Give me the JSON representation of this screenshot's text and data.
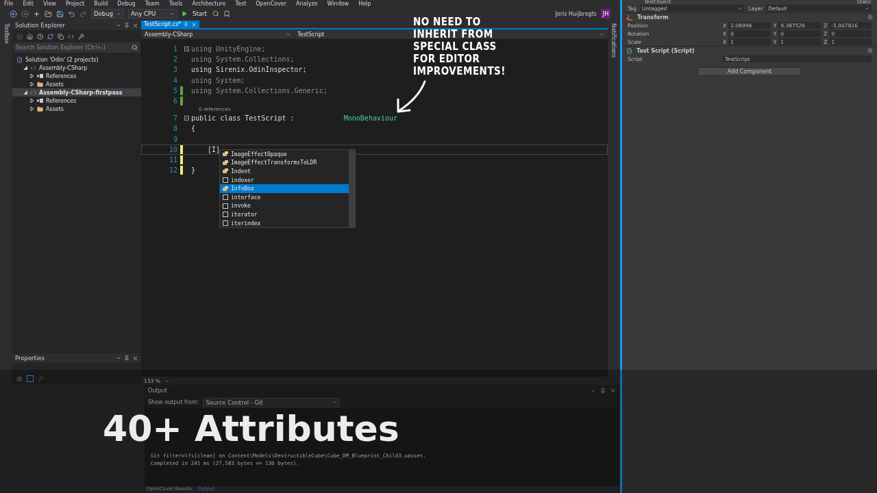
{
  "menu": [
    "File",
    "Edit",
    "View",
    "Project",
    "Build",
    "Debug",
    "Team",
    "Tools",
    "Architecture",
    "Test",
    "OpenCover",
    "Analyze",
    "Window",
    "Help"
  ],
  "toolbar": {
    "configuration": "Debug",
    "platform": "Any CPU",
    "start": "Start",
    "user": "Joris Huijbregts",
    "avatar": "JH"
  },
  "side_tabs": {
    "left": "Toolbox",
    "right": "Notifications"
  },
  "solution_explorer": {
    "title": "Solution Explorer",
    "search": {
      "placeholder": "Search Solution Explorer (Ctrl+;)"
    },
    "tree": [
      {
        "label": "Solution 'Odin' (2 projects)",
        "kind": "solution",
        "selected": false,
        "children": [
          {
            "label": "Assembly-CSharp",
            "kind": "project",
            "expanded": true,
            "selected": false,
            "children": [
              {
                "label": "References",
                "kind": "references",
                "expanded": false,
                "selected": false
              },
              {
                "label": "Assets",
                "kind": "folder",
                "expanded": false,
                "selected": false
              }
            ]
          },
          {
            "label": "Assembly-CSharp-firstpass",
            "kind": "project",
            "expanded": true,
            "selected": true,
            "children": [
              {
                "label": "References",
                "kind": "references",
                "expanded": false,
                "selected": false
              },
              {
                "label": "Assets",
                "kind": "folder",
                "expanded": false,
                "selected": false
              }
            ]
          }
        ]
      }
    ]
  },
  "properties": {
    "title": "Properties"
  },
  "editor": {
    "tab": "TestScript.cs*",
    "nav_project": "Assembly-CSharp",
    "nav_class": "TestScript",
    "codelens": "0 references",
    "zoom": "133 %",
    "lines": [
      {
        "number": "1",
        "fold": true,
        "current": false,
        "changed": false,
        "tokens": [
          {
            "text": "using UnityEngine;",
            "kind": "unused"
          }
        ]
      },
      {
        "number": "2",
        "fold": false,
        "current": false,
        "changed": false,
        "tokens": [
          {
            "text": "using System.Collections;",
            "kind": "unused"
          }
        ]
      },
      {
        "number": "3",
        "fold": false,
        "current": false,
        "changed": false,
        "tokens": [
          {
            "text": "using Sirenix.OdinInspector;",
            "kind": "plain"
          }
        ]
      },
      {
        "number": "4",
        "fold": false,
        "current": false,
        "changed": false,
        "tokens": [
          {
            "text": "using System;",
            "kind": "unused"
          }
        ]
      },
      {
        "number": "5",
        "fold": false,
        "current": false,
        "changed": true,
        "color": "#57a64a",
        "tokens": [
          {
            "text": "using System.Collections.Generic;",
            "kind": "unused"
          }
        ]
      },
      {
        "number": "6",
        "fold": false,
        "current": false,
        "changed": true,
        "color": "#57a64a"
      },
      {
        "number": "7",
        "fold": true,
        "current": false,
        "changed": false,
        "lens": true,
        "tokens": [
          {
            "text": "public class TestScript :            ",
            "kind": "plain"
          },
          {
            "text": "MonoBehaviour",
            "kind": "type"
          }
        ]
      },
      {
        "number": "8",
        "fold": false,
        "current": false,
        "changed": false,
        "tokens": [
          {
            "text": "{",
            "kind": "plain"
          }
        ]
      },
      {
        "number": "9",
        "fold": false,
        "current": false,
        "changed": false
      },
      {
        "number": "10",
        "fold": false,
        "current": true,
        "changed": true,
        "color": "#efeb7a",
        "tokens": [
          {
            "text": "    [I]",
            "kind": "plain"
          }
        ]
      },
      {
        "number": "11",
        "fold": false,
        "current": false,
        "changed": true,
        "color": "#efeb7a"
      },
      {
        "number": "12",
        "fold": false,
        "current": false,
        "changed": true,
        "color": "#efeb7a",
        "tokens": [
          {
            "text": "}",
            "kind": "plain"
          }
        ]
      }
    ],
    "completion": [
      {
        "label": "ImageEffectOpaque",
        "kind": "class",
        "selected": false
      },
      {
        "label": "ImageEffectTransformsToLDR",
        "kind": "class",
        "selected": false
      },
      {
        "label": "Indent",
        "kind": "class",
        "selected": false
      },
      {
        "label": "indexer",
        "kind": "snippet",
        "selected": false
      },
      {
        "label": "InfoBox",
        "kind": "class",
        "selected": true
      },
      {
        "label": "interface",
        "kind": "snippet",
        "selected": false
      },
      {
        "label": "invoke",
        "kind": "snippet",
        "selected": false
      },
      {
        "label": "iterator",
        "kind": "snippet",
        "selected": false
      },
      {
        "label": "iterindex",
        "kind": "snippet",
        "selected": false
      }
    ]
  },
  "annotation": [
    "NO NEED TO",
    "INHERIT FROM",
    "SPECIAL CLASS",
    "FOR EDITOR",
    "IMPROVEMENTS!"
  ],
  "output": {
    "title": "Output",
    "source_label": "Show output from:",
    "source": "Source Control - Git",
    "lines": [
      "Git filter=lfs[clean] on Content\\Models\\DestructibleCube\\Cube_DM_Blueprint_Child3.uasset.",
      "Completed in 241 ms (27,583 bytes => 130 bytes)."
    ],
    "tabs": [
      {
        "label": "OpenCover Results",
        "selected": false
      },
      {
        "label": "Output",
        "selected": true
      }
    ]
  },
  "inspector": {
    "object": "TestObject",
    "static": "Static",
    "tag_label": "Tag",
    "tag": "Untagged",
    "layer_label": "Layer",
    "layer": "Default",
    "components": [
      {
        "title": "Transform",
        "kind": "transform",
        "rows": [
          {
            "label": "Position",
            "values": [
              {
                "axis": "X",
                "value": "2.08998"
              },
              {
                "axis": "Y",
                "value": "9.387526"
              },
              {
                "axis": "Z",
                "value": "-5.007816"
              }
            ]
          },
          {
            "label": "Rotation",
            "values": [
              {
                "axis": "X",
                "value": "0"
              },
              {
                "axis": "Y",
                "value": "0"
              },
              {
                "axis": "Z",
                "value": "0"
              }
            ]
          },
          {
            "label": "Scale",
            "values": [
              {
                "axis": "X",
                "value": "1"
              },
              {
                "axis": "Y",
                "value": "1"
              },
              {
                "axis": "Z",
                "value": "1"
              }
            ]
          }
        ]
      },
      {
        "title": "Test Script (Script)",
        "kind": "script",
        "field_label": "Script",
        "field_value": "TestScript"
      }
    ],
    "add_button": "Add Component"
  },
  "caption": "40+ Attributes"
}
